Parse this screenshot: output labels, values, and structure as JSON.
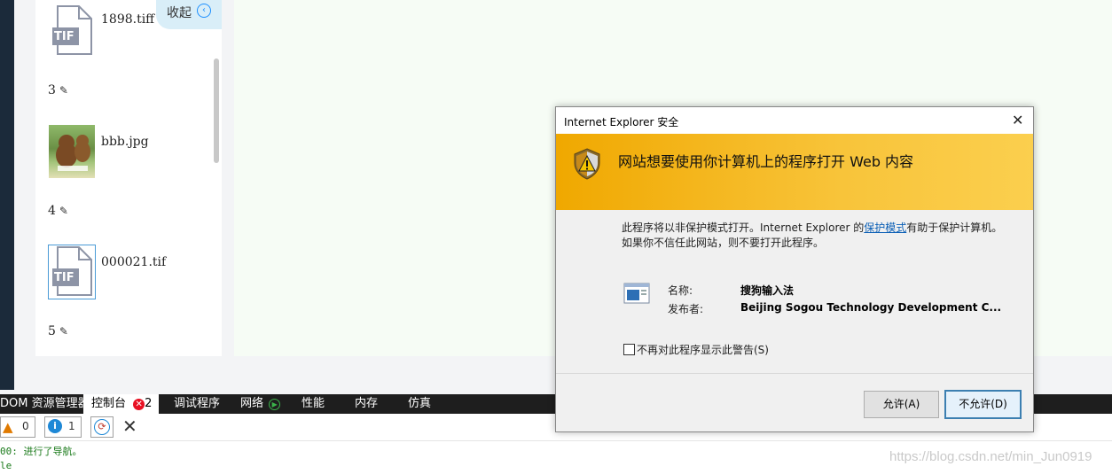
{
  "file_list": {
    "collapse_label": "收起",
    "collapse_icon": "chevron-left-circle-icon",
    "items": [
      {
        "number": "",
        "name": "1898.tiff",
        "icon_label": "TIF"
      },
      {
        "number": "3",
        "name": "bbb.jpg"
      },
      {
        "number": "4",
        "name": "000021.tif",
        "icon_label": "TIF"
      },
      {
        "number": "5"
      }
    ],
    "edit_icon": "pencil-icon"
  },
  "devtools": {
    "tabs": [
      "DOM 资源管理器",
      "控制台",
      "调试程序",
      "网络",
      "性能",
      "内存",
      "仿真"
    ],
    "console_error_count": "2",
    "warning_count": "0",
    "info_count": "1",
    "log_lines": [
      "00: 进行了导航。",
      "le"
    ]
  },
  "dialog": {
    "title": "Internet Explorer 安全",
    "heading": "网站想要使用你计算机上的程序打开 Web 内容",
    "body_line1_prefix": "此程序将以非保护模式打开。Internet Explorer 的",
    "body_link": "保护模式",
    "body_line1_suffix": "有助于保护计算机。",
    "body_line2": "如果你不信任此网站，则不要打开此程序。",
    "name_label": "名称:",
    "name_value": "搜狗输入法",
    "publisher_label": "发布者:",
    "publisher_value": "Beijing Sogou Technology Development C...",
    "checkbox_label": "不再对此程序显示此警告(S)",
    "allow_button": "允许(A)",
    "deny_button": "不允许(D)"
  },
  "watermark": "https://blog.csdn.net/min_Jun0919",
  "colors": {
    "banner": "#f8c43a",
    "deny_button_border": "#3c7fb1",
    "link": "#0b5fb5"
  }
}
